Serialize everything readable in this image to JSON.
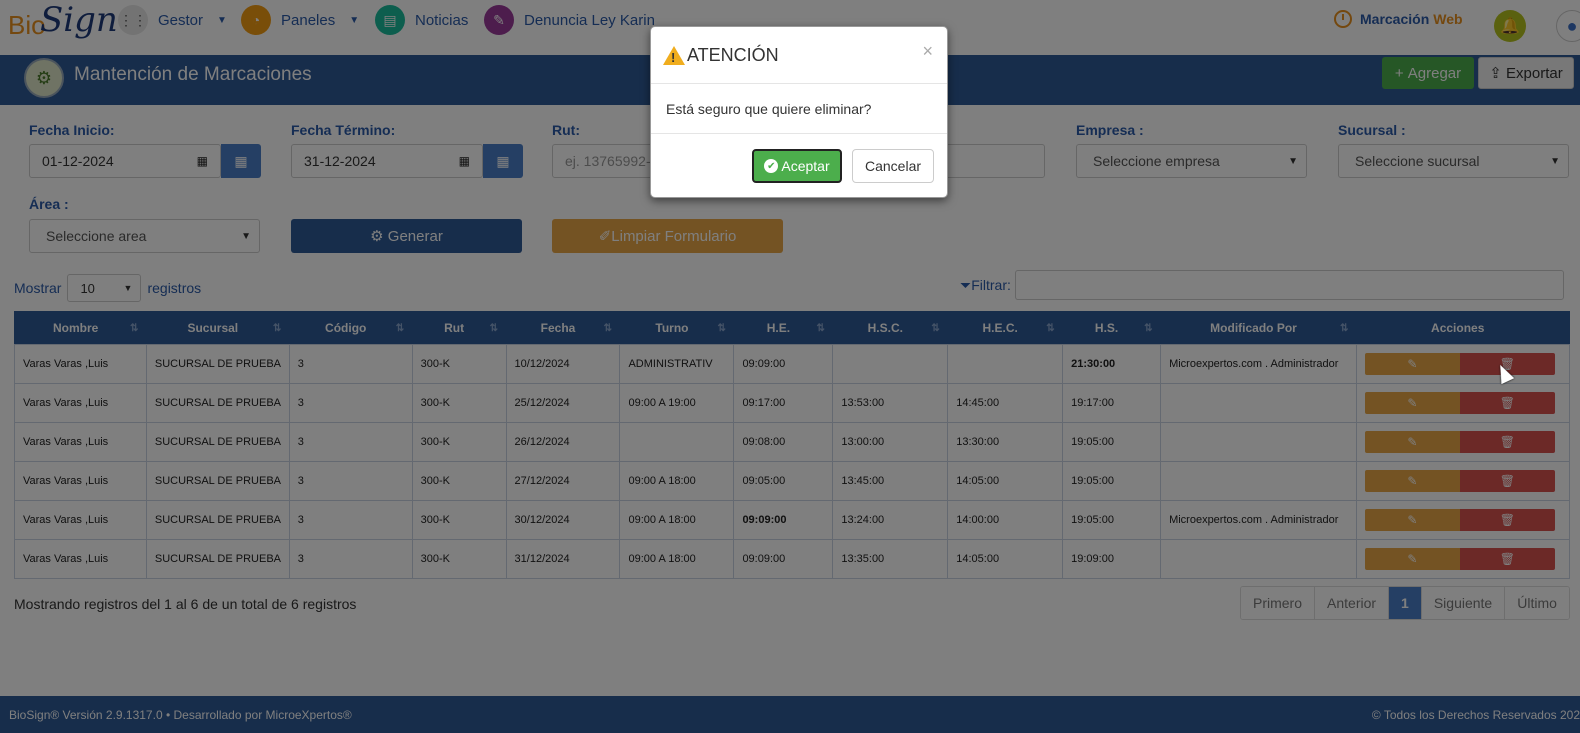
{
  "brand": {
    "bio": "Bio",
    "sign": "Sign"
  },
  "nav": {
    "items": [
      {
        "label": "Gestor",
        "icon": "grid-icon",
        "color": "#e6e6e6"
      },
      {
        "label": "Paneles",
        "icon": "pie-chart-icon",
        "color": "#f39c12"
      },
      {
        "label": "Noticias",
        "icon": "newspaper-icon",
        "color": "#1abc9c"
      },
      {
        "label": "Denuncia Ley Karin",
        "icon": "megaphone-icon",
        "color": "#9b3a9b"
      }
    ],
    "marcacion": "Marcación",
    "web": "Web"
  },
  "header": {
    "title": "Mantención de Marcaciones",
    "add_label": "Agregar",
    "export_label": "Exportar"
  },
  "form": {
    "fecha_inicio_label": "Fecha Inicio:",
    "fecha_inicio_value": "01-12-2024",
    "fecha_termino_label": "Fecha Término:",
    "fecha_termino_value": "31-12-2024",
    "rut_label": "Rut:",
    "rut_placeholder": "ej. 13765992-",
    "empresa_label": "Empresa :",
    "empresa_value": "Seleccione empresa",
    "sucursal_label": "Sucursal :",
    "sucursal_value": "Seleccione sucursal",
    "area_label": "Área :",
    "area_value": "Seleccione area",
    "generar_label": "Generar",
    "limpiar_label": "Limpiar Formulario"
  },
  "list": {
    "mostrar": "Mostrar",
    "length_value": "10",
    "registros": "registros",
    "filtrar": "Filtrar:"
  },
  "table": {
    "headers": [
      "Nombre",
      "Sucursal",
      "Código",
      "Rut",
      "Fecha",
      "Turno",
      "H.E.",
      "H.S.C.",
      "H.E.C.",
      "H.S.",
      "Modificado Por",
      "Acciones"
    ],
    "rows": [
      [
        "Varas Varas ,Luis",
        "SUCURSAL DE PRUEBA",
        "3",
        "300-K",
        "10/12/2024",
        "ADMINISTRATIV",
        "09:09:00",
        "",
        "",
        "21:30:00",
        "Microexpertos.com . Administrador"
      ],
      [
        "Varas Varas ,Luis",
        "SUCURSAL DE PRUEBA",
        "3",
        "300-K",
        "25/12/2024",
        "09:00 A 19:00",
        "09:17:00",
        "13:53:00",
        "14:45:00",
        "19:17:00",
        ""
      ],
      [
        "Varas Varas ,Luis",
        "SUCURSAL DE PRUEBA",
        "3",
        "300-K",
        "26/12/2024",
        "",
        "09:08:00",
        "13:00:00",
        "13:30:00",
        "19:05:00",
        ""
      ],
      [
        "Varas Varas ,Luis",
        "SUCURSAL DE PRUEBA",
        "3",
        "300-K",
        "27/12/2024",
        "09:00 A 18:00",
        "09:05:00",
        "13:45:00",
        "14:05:00",
        "19:05:00",
        ""
      ],
      [
        "Varas Varas ,Luis",
        "SUCURSAL DE PRUEBA",
        "3",
        "300-K",
        "30/12/2024",
        "09:00 A 18:00",
        "09:09:00",
        "13:24:00",
        "14:00:00",
        "19:05:00",
        "Microexpertos.com . Administrador"
      ],
      [
        "Varas Varas ,Luis",
        "SUCURSAL DE PRUEBA",
        "3",
        "300-K",
        "31/12/2024",
        "09:00 A 18:00",
        "09:09:00",
        "13:35:00",
        "14:05:00",
        "19:09:00",
        ""
      ]
    ]
  },
  "info": "Mostrando registros del 1 al 6 de un total de 6 registros",
  "pager": [
    "Primero",
    "Anterior",
    "1",
    "Siguiente",
    "Último"
  ],
  "footer": {
    "left": "BioSign® Versión 2.9.1317.0 • Desarrollado por MicroeXpertos®",
    "right": "© Todos los Derechos Reservados 202"
  },
  "modal": {
    "title": "ATENCIÓN",
    "message": "Está seguro que quiere eliminar?",
    "ok": "Aceptar",
    "cancel": "Cancelar",
    "close": "×"
  }
}
